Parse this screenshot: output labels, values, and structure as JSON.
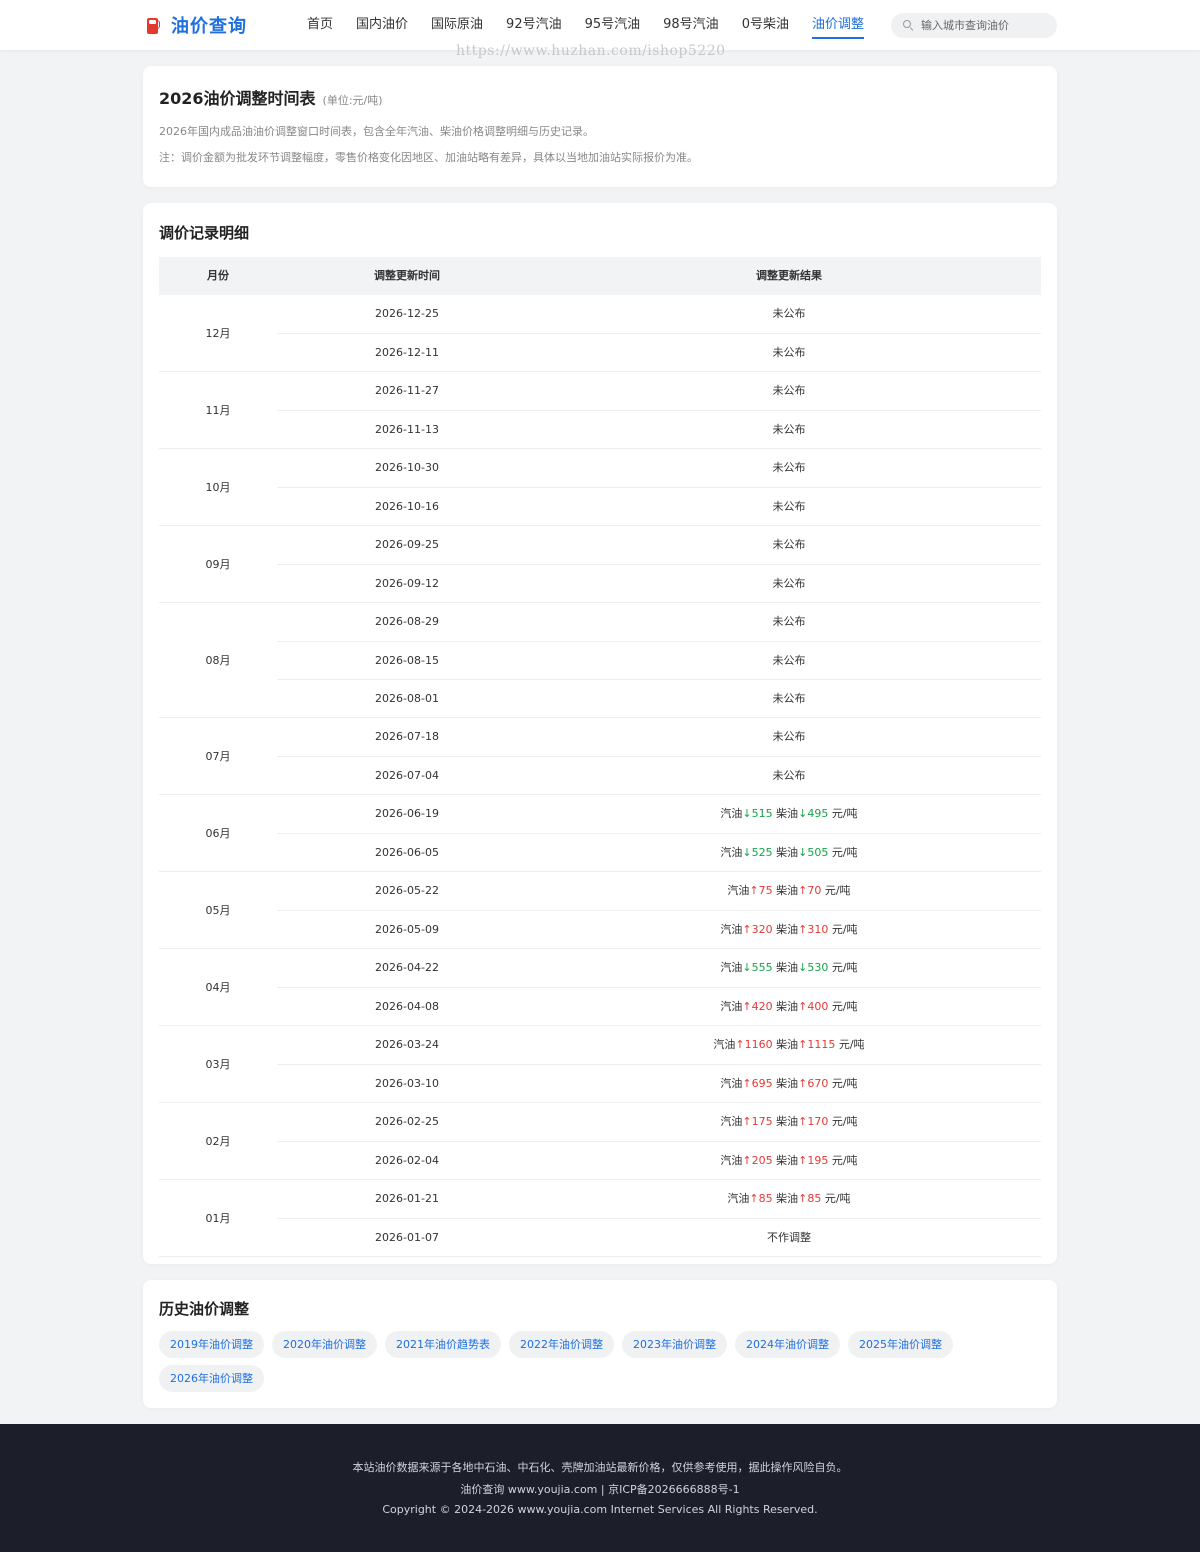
{
  "header": {
    "logo_text": "油价查询",
    "nav": [
      "首页",
      "国内油价",
      "国际原油",
      "92号汽油",
      "95号汽油",
      "98号汽油",
      "0号柴油",
      "油价调整"
    ],
    "active_nav": "油价调整",
    "search_placeholder": "输入城市查询油价"
  },
  "watermark": "https://www.huzhan.com/ishop5220",
  "intro": {
    "title": "2026油价调整时间表",
    "unit": "(单位:元/吨)",
    "desc1": "2026年国内成品油油价调整窗口时间表，包含全年汽油、柴油价格调整明细与历史记录。",
    "desc2": "注：调价金额为批发环节调整幅度，零售价格变化因地区、加油站略有差异，具体以当地加油站实际报价为准。"
  },
  "records": {
    "title": "调价记录明细",
    "columns": [
      "月份",
      "调整更新时间",
      "调整更新结果"
    ],
    "labels": {
      "gas": "汽油",
      "diesel": "柴油",
      "unit": " 元/吨",
      "up": "↑",
      "down": "↓"
    },
    "months": [
      {
        "month": "12月",
        "rows": [
          {
            "date": "2026-12-25",
            "text": "未公布"
          },
          {
            "date": "2026-12-11",
            "text": "未公布"
          }
        ]
      },
      {
        "month": "11月",
        "rows": [
          {
            "date": "2026-11-27",
            "text": "未公布"
          },
          {
            "date": "2026-11-13",
            "text": "未公布"
          }
        ]
      },
      {
        "month": "10月",
        "rows": [
          {
            "date": "2026-10-30",
            "text": "未公布"
          },
          {
            "date": "2026-10-16",
            "text": "未公布"
          }
        ]
      },
      {
        "month": "09月",
        "rows": [
          {
            "date": "2026-09-25",
            "text": "未公布"
          },
          {
            "date": "2026-09-12",
            "text": "未公布"
          }
        ]
      },
      {
        "month": "08月",
        "rows": [
          {
            "date": "2026-08-29",
            "text": "未公布"
          },
          {
            "date": "2026-08-15",
            "text": "未公布"
          },
          {
            "date": "2026-08-01",
            "text": "未公布"
          }
        ]
      },
      {
        "month": "07月",
        "rows": [
          {
            "date": "2026-07-18",
            "text": "未公布"
          },
          {
            "date": "2026-07-04",
            "text": "未公布"
          }
        ]
      },
      {
        "month": "06月",
        "rows": [
          {
            "date": "2026-06-19",
            "gas_dir": "down",
            "gas": "515",
            "diesel_dir": "down",
            "diesel": "495"
          },
          {
            "date": "2026-06-05",
            "gas_dir": "down",
            "gas": "525",
            "diesel_dir": "down",
            "diesel": "505"
          }
        ]
      },
      {
        "month": "05月",
        "rows": [
          {
            "date": "2026-05-22",
            "gas_dir": "up",
            "gas": "75",
            "diesel_dir": "up",
            "diesel": "70"
          },
          {
            "date": "2026-05-09",
            "gas_dir": "up",
            "gas": "320",
            "diesel_dir": "up",
            "diesel": "310"
          }
        ]
      },
      {
        "month": "04月",
        "rows": [
          {
            "date": "2026-04-22",
            "gas_dir": "down",
            "gas": "555",
            "diesel_dir": "down",
            "diesel": "530"
          },
          {
            "date": "2026-04-08",
            "gas_dir": "up",
            "gas": "420",
            "diesel_dir": "up",
            "diesel": "400"
          }
        ]
      },
      {
        "month": "03月",
        "rows": [
          {
            "date": "2026-03-24",
            "gas_dir": "up",
            "gas": "1160",
            "diesel_dir": "up",
            "diesel": "1115"
          },
          {
            "date": "2026-03-10",
            "gas_dir": "up",
            "gas": "695",
            "diesel_dir": "up",
            "diesel": "670"
          }
        ]
      },
      {
        "month": "02月",
        "rows": [
          {
            "date": "2026-02-25",
            "gas_dir": "up",
            "gas": "175",
            "diesel_dir": "up",
            "diesel": "170"
          },
          {
            "date": "2026-02-04",
            "gas_dir": "up",
            "gas": "205",
            "diesel_dir": "up",
            "diesel": "195"
          }
        ]
      },
      {
        "month": "01月",
        "rows": [
          {
            "date": "2026-01-21",
            "gas_dir": "up",
            "gas": "85",
            "diesel_dir": "up",
            "diesel": "85"
          },
          {
            "date": "2026-01-07",
            "text": "不作调整"
          }
        ]
      }
    ]
  },
  "history": {
    "title": "历史油价调整",
    "tags": [
      "2019年油价调整",
      "2020年油价调整",
      "2021年油价趋势表",
      "2022年油价调整",
      "2023年油价调整",
      "2024年油价调整",
      "2025年油价调整",
      "2026年油价调整"
    ]
  },
  "footer": {
    "line1": "本站油价数据来源于各地中石油、中石化、壳牌加油站最新价格，仅供参考使用，据此操作风险自负。",
    "line2": "油价查询 www.youjia.com | 京ICP备2026666888号-1",
    "line3": "Copyright © 2024-2026 www.youjia.com Internet Services All Rights Reserved."
  },
  "colors": {
    "accent": "#1f6fe0",
    "up": "#e53935",
    "down": "#17a34a",
    "footer_bg": "#1c1f2a"
  }
}
